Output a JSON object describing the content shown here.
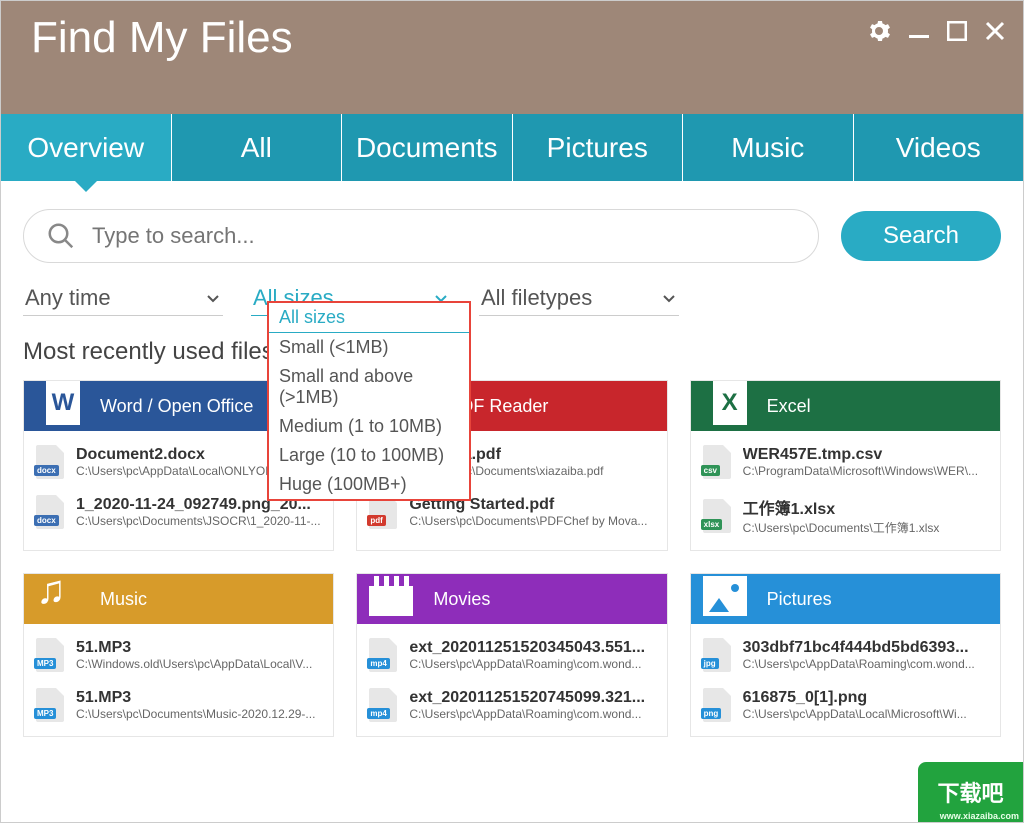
{
  "app": {
    "title": "Find My Files"
  },
  "tabs": [
    "Overview",
    "All",
    "Documents",
    "Pictures",
    "Music",
    "Videos"
  ],
  "active_tab": 0,
  "search": {
    "placeholder": "Type to search...",
    "button": "Search"
  },
  "filters": {
    "time": {
      "label": "Any time"
    },
    "size": {
      "label": "All sizes",
      "open": true,
      "options": [
        "All sizes",
        "Small (<1MB)",
        "Small and above (>1MB)",
        "Medium (1 to 10MB)",
        "Large (10 to 100MB)",
        "Huge (100MB+)"
      ],
      "selected": 0
    },
    "type": {
      "label": "All filetypes"
    }
  },
  "section_label": "Most recently used files",
  "cards": [
    {
      "title": "Word / Open Office",
      "cls": "hd-word",
      "icon": "icon-word",
      "glyph": "W",
      "files": [
        {
          "badge": "docx",
          "bcolor": "#3c6fb3",
          "name": "Document2.docx",
          "path": "C:\\Users\\pc\\AppData\\Local\\ONLYOFFICE\\..."
        },
        {
          "badge": "docx",
          "bcolor": "#3c6fb3",
          "name": "1_2020-11-24_092749.png_20...",
          "path": "C:\\Users\\pc\\Documents\\JSOCR\\1_2020-11-..."
        }
      ]
    },
    {
      "title": "e PDF Reader",
      "cls": "hd-pdf",
      "icon": "icon-pdf",
      "glyph": "",
      "files": [
        {
          "badge": "pdf",
          "bcolor": "#d23a2e",
          "name": "xiazaiba.pdf",
          "path": "C:\\Users\\pc\\Documents\\xiazaiba.pdf"
        },
        {
          "badge": "pdf",
          "bcolor": "#d23a2e",
          "name": "Getting Started.pdf",
          "path": "C:\\Users\\pc\\Documents\\PDFChef by Mova..."
        }
      ]
    },
    {
      "title": "Excel",
      "cls": "hd-excel",
      "icon": "icon-excel",
      "glyph": "X",
      "files": [
        {
          "badge": "csv",
          "bcolor": "#2f9357",
          "name": "WER457E.tmp.csv",
          "path": "C:\\ProgramData\\Microsoft\\Windows\\WER\\..."
        },
        {
          "badge": "xlsx",
          "bcolor": "#2f9357",
          "name": "工作簿1.xlsx",
          "path": "C:\\Users\\pc\\Documents\\工作簿1.xlsx"
        }
      ]
    },
    {
      "title": "Music",
      "cls": "hd-music",
      "icon": "icon-music",
      "glyph": "",
      "files": [
        {
          "badge": "MP3",
          "bcolor": "#2690d8",
          "name": "51.MP3",
          "path": "C:\\Windows.old\\Users\\pc\\AppData\\Local\\V..."
        },
        {
          "badge": "MP3",
          "bcolor": "#2690d8",
          "name": "51.MP3",
          "path": "C:\\Users\\pc\\Documents\\Music-2020.12.29-..."
        }
      ]
    },
    {
      "title": "Movies",
      "cls": "hd-movies",
      "icon": "icon-movies",
      "glyph": "",
      "files": [
        {
          "badge": "mp4",
          "bcolor": "#2690d8",
          "name": "ext_202011251520345043.551...",
          "path": "C:\\Users\\pc\\AppData\\Roaming\\com.wond..."
        },
        {
          "badge": "mp4",
          "bcolor": "#2690d8",
          "name": "ext_202011251520745099.321...",
          "path": "C:\\Users\\pc\\AppData\\Roaming\\com.wond..."
        }
      ]
    },
    {
      "title": "Pictures",
      "cls": "hd-pictures",
      "icon": "icon-pictures",
      "glyph": "",
      "files": [
        {
          "badge": "jpg",
          "bcolor": "#2690d8",
          "name": "303dbf71bc4f444bd5bd6393...",
          "path": "C:\\Users\\pc\\AppData\\Roaming\\com.wond..."
        },
        {
          "badge": "png",
          "bcolor": "#2690d8",
          "name": "616875_0[1].png",
          "path": "C:\\Users\\pc\\AppData\\Local\\Microsoft\\Wi..."
        }
      ]
    }
  ],
  "watermark": {
    "main": "下载吧",
    "sub": "www.xiazaiba.com"
  }
}
